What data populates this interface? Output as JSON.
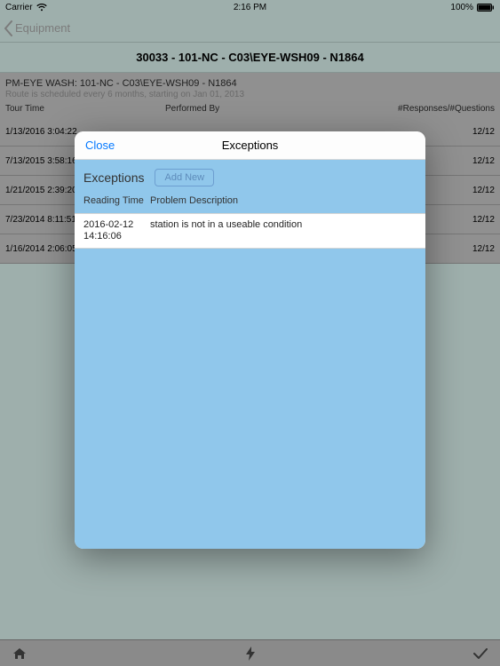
{
  "status": {
    "carrier": "Carrier",
    "time": "2:16 PM",
    "battery": "100%"
  },
  "nav": {
    "back_label": "Equipment"
  },
  "title": "30033 - 101-NC - C03\\EYE-WSH09 - N1864",
  "subheader": {
    "line1": "PM-EYE WASH: 101-NC - C03\\EYE-WSH09 - N1864",
    "line2": "Route is scheduled every 6 months, starting on Jan 01, 2013",
    "columns": {
      "tour": "Tour Time",
      "performed": "Performed By",
      "responses": "#Responses/#Questions"
    }
  },
  "rows": [
    {
      "time": "1/13/2016 3:04:22",
      "performed": "",
      "resp": "12/12"
    },
    {
      "time": "7/13/2015 3:58:16",
      "performed": "",
      "resp": "12/12"
    },
    {
      "time": "1/21/2015 2:39:20",
      "performed": "",
      "resp": "12/12"
    },
    {
      "time": "7/23/2014 8:11:51",
      "performed": "",
      "resp": "12/12"
    },
    {
      "time": "1/16/2014 2:06:05",
      "performed": "",
      "resp": "12/12"
    }
  ],
  "modal": {
    "close": "Close",
    "title": "Exceptions",
    "section_title": "Exceptions",
    "add_new": "Add New",
    "columns": {
      "reading_time": "Reading Time",
      "problem_desc": "Problem Description"
    },
    "exceptions": [
      {
        "time": "2016-02-12 14:16:06",
        "desc": "station is not in a useable condition"
      }
    ]
  }
}
